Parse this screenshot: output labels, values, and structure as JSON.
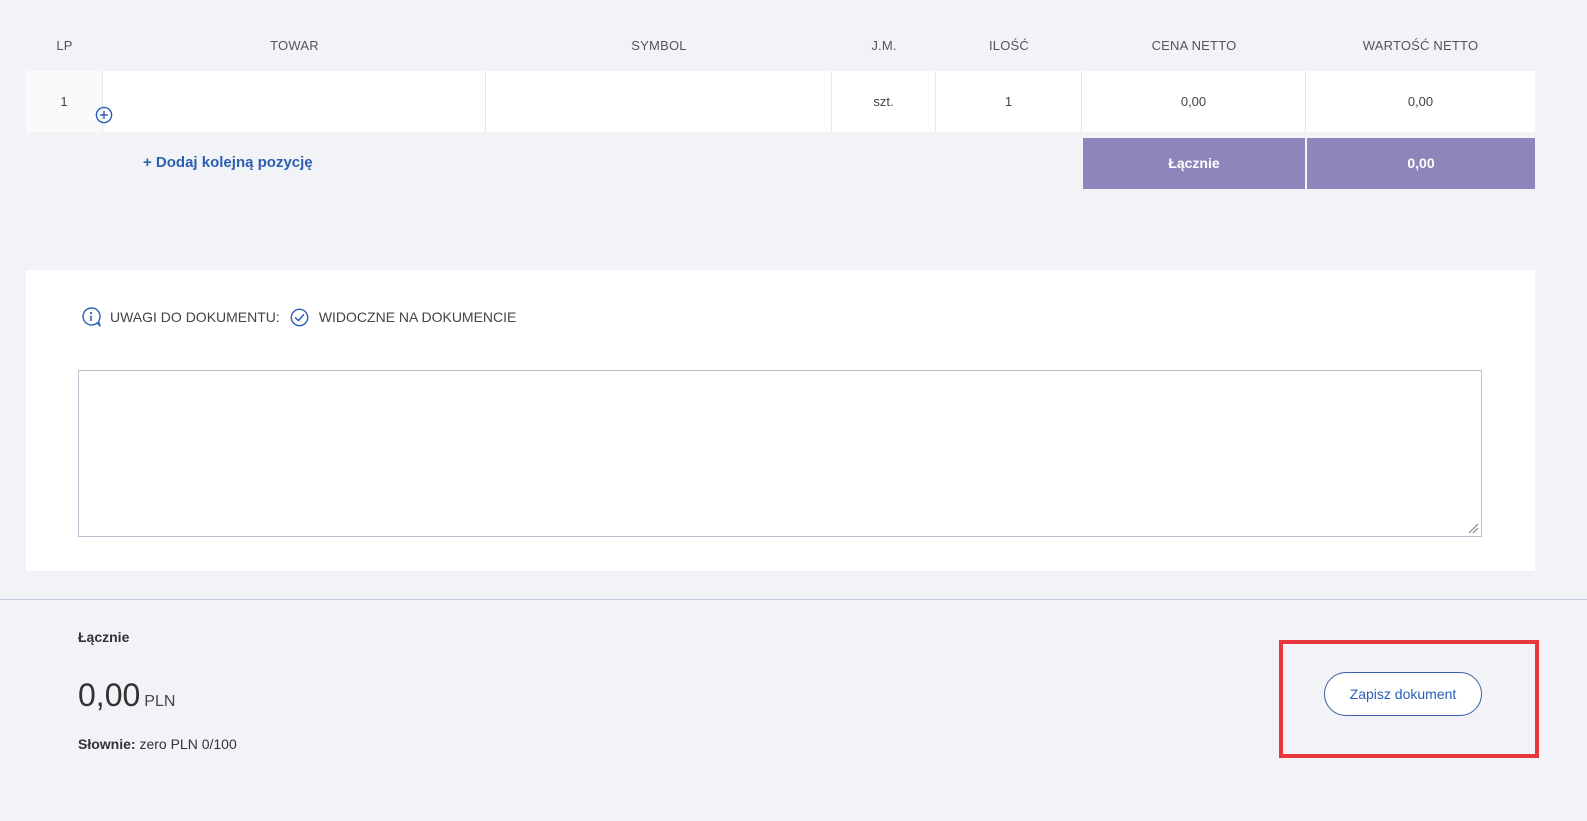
{
  "table": {
    "headers": {
      "lp": "LP",
      "towar": "TOWAR",
      "symbol": "SYMBOL",
      "jm": "J.M.",
      "ilosc": "ILOŚĆ",
      "cena_netto": "CENA NETTO",
      "wartosc_netto": "WARTOŚĆ NETTO"
    },
    "rows": [
      {
        "lp": "1",
        "towar": "",
        "symbol": "",
        "jm": "szt.",
        "ilosc": "1",
        "cena_netto": "0,00",
        "wartosc_netto": "0,00"
      }
    ],
    "add_position_label": "+ Dodaj kolejną pozycję",
    "sum_label": "Łącznie",
    "sum_value": "0,00"
  },
  "notes": {
    "label": "UWAGI DO DOKUMENTU:",
    "visibility_label": "WIDOCZNE NA DOKUMENCIE",
    "value": ""
  },
  "summary": {
    "label": "Łącznie",
    "amount": "0,00",
    "currency": "PLN",
    "words_label": "Słownie:",
    "words_value": "zero PLN 0/100"
  },
  "actions": {
    "save_label": "Zapisz dokument"
  },
  "colors": {
    "accent": "#2c5fb3",
    "sum_background": "#8e86bb",
    "highlight": "#e8383d"
  }
}
